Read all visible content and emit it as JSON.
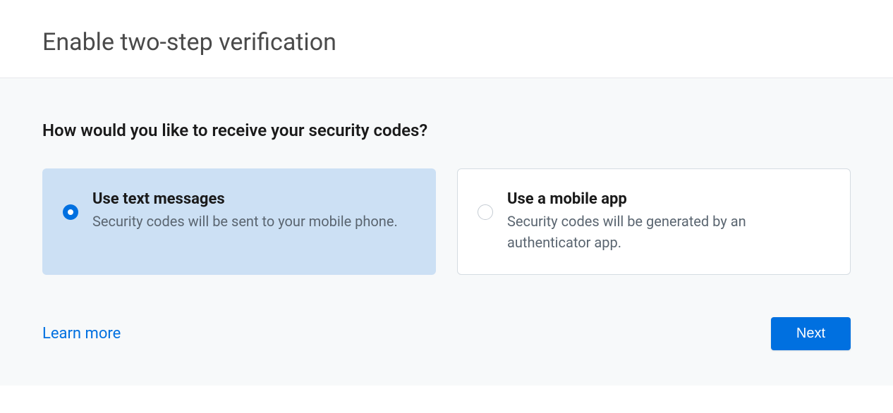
{
  "header": {
    "title": "Enable two-step verification"
  },
  "content": {
    "question": "How would you like to receive your security codes?",
    "options": [
      {
        "title": "Use text messages",
        "description": "Security codes will be sent to your mobile phone.",
        "selected": true
      },
      {
        "title": "Use a mobile app",
        "description": "Security codes will be generated by an authenticator app.",
        "selected": false
      }
    ],
    "learn_more_label": "Learn more",
    "next_button_label": "Next"
  }
}
